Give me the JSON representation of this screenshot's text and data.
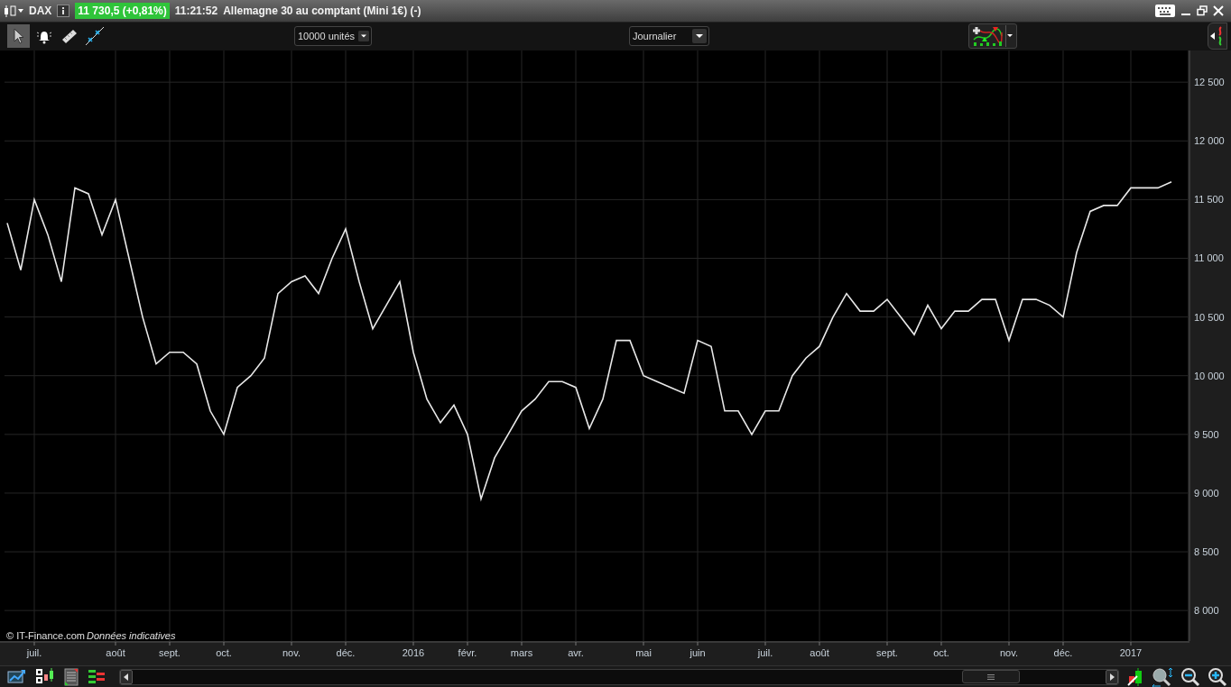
{
  "title_bar": {
    "instrument": "DAX",
    "price": "11 730,5 (+0,81%)",
    "price_up": true,
    "time": "11:21:52",
    "title": "Allemagne 30 au comptant (Mini 1€) (-)"
  },
  "toolbar": {
    "tools": [
      {
        "kind": "pointer",
        "selected": true
      },
      {
        "kind": "alert",
        "selected": false
      },
      {
        "kind": "ruler",
        "selected": false
      },
      {
        "kind": "line",
        "selected": false
      }
    ],
    "units": "10000 unités",
    "period": "Journalier"
  },
  "chart": {
    "copyright": "© IT-Finance.com",
    "note": "Données indicatives",
    "chart_data": {
      "type": "line",
      "grid": true,
      "categories": [
        null,
        null,
        "juil.",
        null,
        null,
        null,
        null,
        null,
        "août",
        null,
        null,
        null,
        "sept.",
        null,
        null,
        null,
        "oct.",
        null,
        null,
        null,
        null,
        "nov.",
        null,
        null,
        null,
        "déc.",
        null,
        null,
        null,
        null,
        "2016",
        null,
        null,
        null,
        "févr.",
        null,
        null,
        null,
        "mars",
        null,
        null,
        null,
        "avr.",
        null,
        null,
        null,
        null,
        "mai",
        null,
        null,
        null,
        "juin",
        null,
        null,
        null,
        null,
        "juil.",
        null,
        null,
        null,
        "août",
        null,
        null,
        null,
        null,
        "sept.",
        null,
        null,
        null,
        "oct.",
        null,
        null,
        null,
        null,
        "nov.",
        null,
        null,
        null,
        "déc.",
        null,
        null,
        null,
        null,
        "2017",
        null,
        null,
        null
      ],
      "ylim": [
        7740,
        12770
      ],
      "yticks": [
        {
          "value": 8000,
          "label": "8 000"
        },
        {
          "value": 8500,
          "label": "8 500"
        },
        {
          "value": 9000,
          "label": "9 000"
        },
        {
          "value": 9500,
          "label": "9 500"
        },
        {
          "value": 10000,
          "label": "10 000"
        },
        {
          "value": 10500,
          "label": "10 500"
        },
        {
          "value": 11000,
          "label": "11 000"
        },
        {
          "value": 11500,
          "label": "11 500"
        },
        {
          "value": 12000,
          "label": "12 000"
        },
        {
          "value": 12500,
          "label": "12 500"
        }
      ],
      "series": [
        {
          "color": "#e8e8e8",
          "values": [
            11300,
            10900,
            11500,
            11200,
            10800,
            11600,
            11550,
            11200,
            11500,
            11000,
            10500,
            10100,
            10200,
            10200,
            10100,
            9700,
            9500,
            9900,
            10000,
            10150,
            10700,
            10800,
            10850,
            10700,
            11000,
            11250,
            10800,
            10400,
            10600,
            10800,
            10200,
            9800,
            9600,
            9750,
            9500,
            8950,
            9300,
            9500,
            9700,
            9800,
            9950,
            9950,
            9900,
            9550,
            9800,
            10300,
            10300,
            10000,
            9950,
            9900,
            9850,
            10300,
            10250,
            9700,
            9700,
            9500,
            9700,
            9700,
            10000,
            10150,
            10250,
            10500,
            10700,
            10550,
            10550,
            10650,
            10500,
            10350,
            10600,
            10400,
            10550,
            10550,
            10650,
            10650,
            10300,
            10650,
            10650,
            10600,
            10500,
            11050,
            11400,
            11450,
            11450,
            11600,
            11600,
            11600,
            11650
          ]
        }
      ]
    }
  }
}
